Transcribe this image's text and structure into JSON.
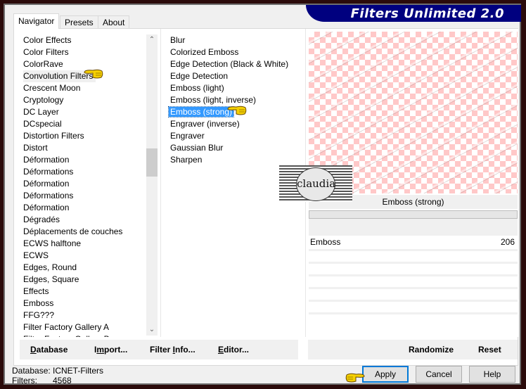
{
  "window": {
    "title": "Filters Unlimited 2.0"
  },
  "tabs": [
    {
      "label": "Navigator",
      "active": true
    },
    {
      "label": "Presets",
      "active": false
    },
    {
      "label": "About",
      "active": false
    }
  ],
  "categories": {
    "items": [
      "Color Effects",
      "Color Filters",
      "ColorRave",
      "Convolution Filters",
      "Crescent Moon",
      "Cryptology",
      "DC Layer",
      "DCspecial",
      "Distortion Filters",
      "Distort",
      "Déformation",
      "Déformations",
      "Déformation",
      "Déformations",
      "Déformation",
      "Dégradés",
      "Déplacements de couches",
      "ECWS halftone",
      "ECWS",
      "Edges, Round",
      "Edges, Square",
      "Effects",
      "Emboss",
      "FFG???",
      "Filter Factory Gallery A",
      "Filter Factory Gallery B"
    ],
    "selected_index": 3,
    "scroll_up_icon": "chevron-up-icon",
    "scroll_down_icon": "chevron-down-icon"
  },
  "filters": {
    "items": [
      "Blur",
      "Colorized Emboss",
      "Edge Detection (Black & White)",
      "Edge Detection",
      "Emboss (light)",
      "Emboss (light, inverse)",
      "Emboss (strong)",
      "Engraver (inverse)",
      "Engraver",
      "Gaussian Blur",
      "Sharpen"
    ],
    "selected_index": 6
  },
  "preview": {
    "filter_name": "Emboss (strong)",
    "watermark": "claudia",
    "checker_color": "#ffc8c8"
  },
  "parameters": [
    {
      "label": "Emboss",
      "value": "206"
    }
  ],
  "toolbar_left": {
    "database": {
      "label": "Database",
      "mnemonic": "D"
    },
    "import": {
      "label": "Import...",
      "mnemonic": "m"
    },
    "filter_info": {
      "label": "Filter Info...",
      "mnemonic": "I"
    },
    "editor": {
      "label": "Editor...",
      "mnemonic": "E"
    }
  },
  "toolbar_right": {
    "randomize": "Randomize",
    "reset": "Reset"
  },
  "status": {
    "database_label": "Database:",
    "database_value": "ICNET-Filters",
    "filters_label": "Filters:",
    "filters_value": "4568"
  },
  "buttons": {
    "apply": "Apply",
    "cancel": "Cancel",
    "help": "Help"
  },
  "colors": {
    "banner": "#00007f",
    "selection": "#3399ff",
    "frame": "#2b0b0b",
    "default_button_border": "#0078d7"
  }
}
